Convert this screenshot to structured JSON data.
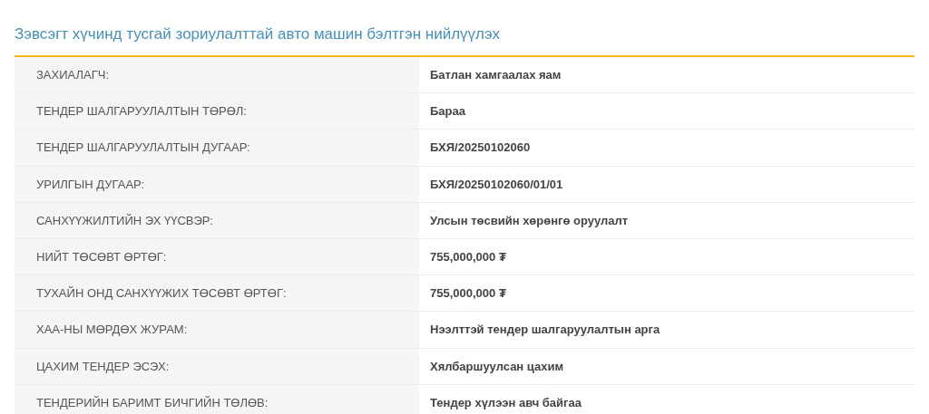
{
  "title": "Зэвсэгт хүчинд тусгай зориулалттай авто машин бэлтгэн нийлүүлэх",
  "rows": [
    {
      "label": "ЗАХИАЛАГЧ:",
      "value": "Батлан хамгаалах яам"
    },
    {
      "label": "ТЕНДЕР ШАЛГАРУУЛАЛТЫН ТӨРӨЛ:",
      "value": "Бараа"
    },
    {
      "label": "ТЕНДЕР ШАЛГАРУУЛАЛТЫН ДУГААР:",
      "value": "БХЯ/20250102060"
    },
    {
      "label": "УРИЛГЫН ДУГААР:",
      "value": "БХЯ/20250102060/01/01"
    },
    {
      "label": "САНХҮҮЖИЛТИЙН ЭХ ҮҮСВЭР:",
      "value": "Улсын төсвийн хөрөнгө оруулалт"
    },
    {
      "label": "НИЙТ ТӨСӨВТ ӨРТӨГ:",
      "value": "755,000,000 ₮"
    },
    {
      "label": "ТУХАЙН ОНД САНХҮҮЖИХ ТӨСӨВТ ӨРТӨГ:",
      "value": "755,000,000 ₮"
    },
    {
      "label": "ХАА-НЫ МӨРДӨХ ЖУРАМ:",
      "value": "Нээлттэй тендер шалгаруулалтын арга"
    },
    {
      "label": "ЦАХИМ ТЕНДЕР ЭСЭХ:",
      "value": "Хялбаршуулсан цахим"
    },
    {
      "label": "ТЕНДЕРИЙН БАРИМТ БИЧГИЙН ТӨЛӨВ:",
      "value": "Тендер хүлээн авч байгаа"
    }
  ]
}
